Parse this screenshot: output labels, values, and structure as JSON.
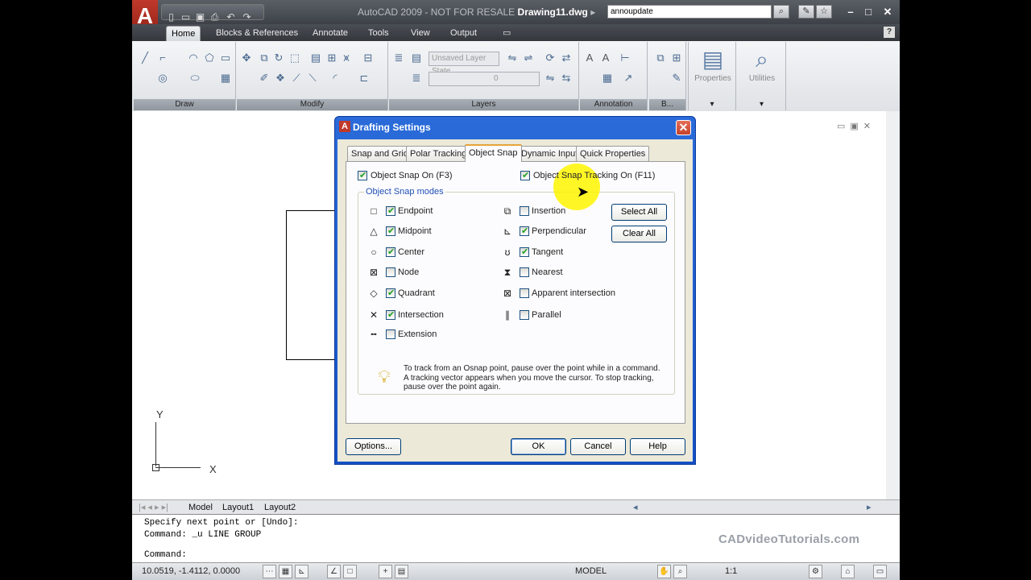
{
  "app": {
    "title_prefix": "AutoCAD 2009 - NOT FOR RESALE",
    "filename": "Drawing11.dwg",
    "search_value": "annoupdate",
    "logo_letter": "A"
  },
  "quick_access": [
    "new-icon",
    "open-icon",
    "save-icon",
    "plot-icon",
    "undo-icon",
    "redo-icon"
  ],
  "ribbon_tabs": [
    "Home",
    "Blocks & References",
    "Annotate",
    "Tools",
    "View",
    "Output"
  ],
  "ribbon_panels": [
    "Draw",
    "Modify",
    "Layers",
    "Annotation",
    "B...",
    "Properties",
    "Utilities"
  ],
  "layer_combo": "Unsaved Layer State",
  "layer_combo2": "0",
  "layout_tabs": [
    "Model",
    "Layout1",
    "Layout2"
  ],
  "command": {
    "line1": "Specify next point or [Undo]:",
    "line2": "Command: _u LINE GROUP",
    "line3": "Command:",
    "watermark": "CADvideoTutorials.com"
  },
  "status": {
    "coords": "10.0519, -1.4112, 0.0000",
    "model": "MODEL",
    "scale": "1:1"
  },
  "ucs": {
    "x": "X",
    "y": "Y"
  },
  "dialog": {
    "title": "Drafting Settings",
    "tabs": [
      "Snap and Grid",
      "Polar Tracking",
      "Object Snap",
      "Dynamic Input",
      "Quick Properties"
    ],
    "active_tab": "Object Snap",
    "osnap_on": "Object Snap On (F3)",
    "tracking_on": "Object Snap Tracking On (F11)",
    "group_label": "Object Snap modes",
    "modes_left": [
      {
        "label": "Endpoint",
        "checked": true,
        "symbol": "□"
      },
      {
        "label": "Midpoint",
        "checked": true,
        "symbol": "△"
      },
      {
        "label": "Center",
        "checked": true,
        "symbol": "○"
      },
      {
        "label": "Node",
        "checked": false,
        "symbol": "⊠"
      },
      {
        "label": "Quadrant",
        "checked": true,
        "symbol": "◇"
      },
      {
        "label": "Intersection",
        "checked": true,
        "symbol": "✕"
      },
      {
        "label": "Extension",
        "checked": false,
        "symbol": "╍"
      }
    ],
    "modes_right": [
      {
        "label": "Insertion",
        "checked": false,
        "symbol": "⧉"
      },
      {
        "label": "Perpendicular",
        "checked": true,
        "symbol": "⊾"
      },
      {
        "label": "Tangent",
        "checked": true,
        "symbol": "ʊ"
      },
      {
        "label": "Nearest",
        "checked": false,
        "symbol": "⧗"
      },
      {
        "label": "Apparent intersection",
        "checked": false,
        "symbol": "⊠"
      },
      {
        "label": "Parallel",
        "checked": false,
        "symbol": "∥"
      }
    ],
    "select_all": "Select All",
    "clear_all": "Clear All",
    "tip": "To track from an Osnap point, pause over the point while in a command.  A tracking vector appears when you move the cursor. To stop tracking, pause over the point again.",
    "options": "Options...",
    "ok": "OK",
    "cancel": "Cancel",
    "help": "Help"
  }
}
